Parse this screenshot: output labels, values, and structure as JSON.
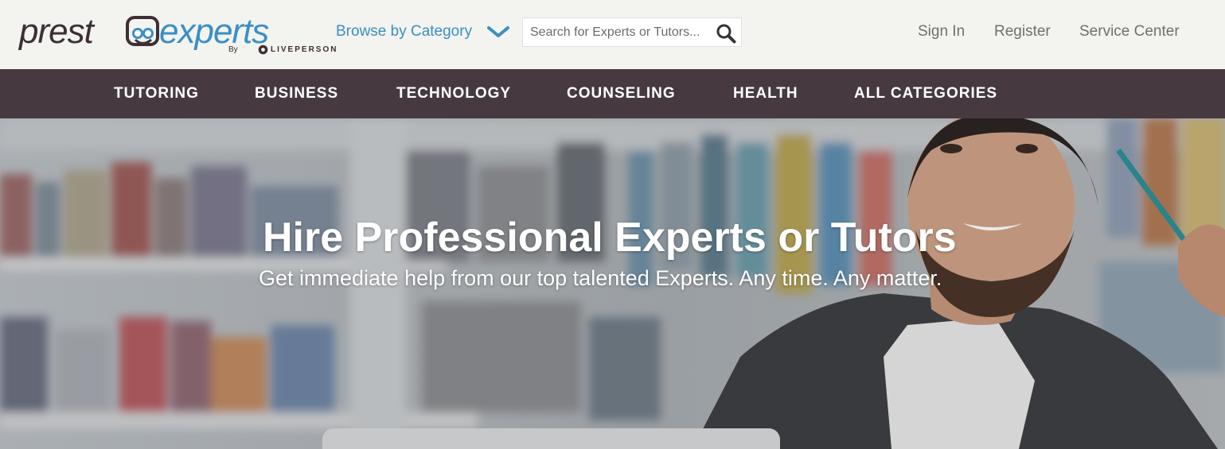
{
  "brand": {
    "logo_text": "prestoexperts",
    "byline_by": "By",
    "byline_company": "LIVEPERSON"
  },
  "header": {
    "browse_label": "Browse by Category",
    "search": {
      "placeholder": "Search for Experts or Tutors...",
      "value": ""
    },
    "user_nav": [
      {
        "label": "Sign In"
      },
      {
        "label": "Register"
      },
      {
        "label": "Service Center"
      }
    ]
  },
  "categories": [
    {
      "label": "TUTORING"
    },
    {
      "label": "BUSINESS"
    },
    {
      "label": "TECHNOLOGY"
    },
    {
      "label": "COUNSELING"
    },
    {
      "label": "HEALTH"
    },
    {
      "label": "ALL CATEGORIES"
    }
  ],
  "hero": {
    "title": "Hire Professional Experts or Tutors",
    "subtitle": "Get immediate help from our top talented Experts. Any time. Any matter."
  },
  "colors": {
    "header_bg": "#f3f3ef",
    "brand_dark": "#3d2f35",
    "brand_blue": "#3a8fc5",
    "category_bar": "#463a40",
    "nav_text": "#6f6f6f"
  },
  "icons": {
    "browse_chevron": "chevron-down-icon",
    "search_button": "search-icon",
    "logo_mascot": "glasses-mascot-icon"
  }
}
